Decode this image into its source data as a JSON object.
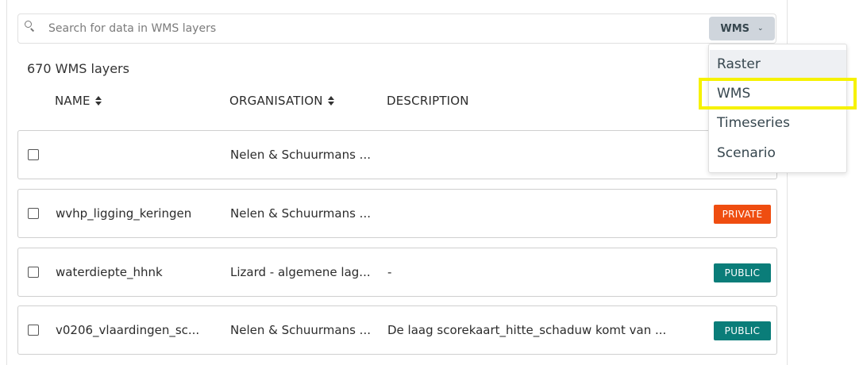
{
  "search": {
    "placeholder": "Search for data in WMS layers",
    "value": "",
    "type_button_label": "WMS",
    "type_options": [
      "Raster",
      "WMS",
      "Timeseries",
      "Scenario"
    ]
  },
  "results": {
    "count_label": "670 WMS layers"
  },
  "table": {
    "headers": {
      "name": "NAME",
      "organisation": "ORGANISATION",
      "description": "DESCRIPTION"
    },
    "rows": [
      {
        "name": "",
        "organisation": "Nelen & Schuurmans ...",
        "description": "",
        "badge": ""
      },
      {
        "name": "wvhp_ligging_keringen",
        "organisation": "Nelen & Schuurmans ...",
        "description": "",
        "badge": "PRIVATE"
      },
      {
        "name": "waterdiepte_hhnk",
        "organisation": "Lizard - algemene lag...",
        "description": "-",
        "badge": "PUBLIC"
      },
      {
        "name": "v0206_vlaardingen_sc...",
        "organisation": "Nelen & Schuurmans ...",
        "description": "De laag scorekaart_hitte_schaduw komt van ...",
        "badge": "PUBLIC"
      }
    ]
  },
  "icons": {
    "search": "search-icon",
    "sort": "sort-icon",
    "chevron": "chevron-down-icon"
  },
  "colors": {
    "private_badge": "#ef4d10",
    "public_badge": "#0a7d79",
    "highlight": "#f6f200",
    "type_button_bg": "#cfd5dc"
  }
}
